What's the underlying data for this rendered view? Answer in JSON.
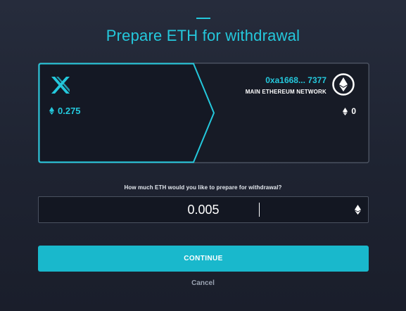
{
  "title": "Prepare ETH for withdrawal",
  "colors": {
    "accent": "#24c8dc",
    "button": "#19b8cc",
    "background": "#1e2331"
  },
  "source": {
    "logo_icon": "immutable-x-icon",
    "balance": "0.275"
  },
  "destination": {
    "address": "0xa1668... 7377",
    "network": "MAIN ETHEREUM NETWORK",
    "logo_icon": "ethereum-icon",
    "balance": "0"
  },
  "form": {
    "question": "How much ETH would you like to prepare for withdrawal?",
    "amount": "0.005",
    "currency_icon": "ethereum-icon"
  },
  "actions": {
    "continue_label": "CONTINUE",
    "cancel_label": "Cancel"
  }
}
